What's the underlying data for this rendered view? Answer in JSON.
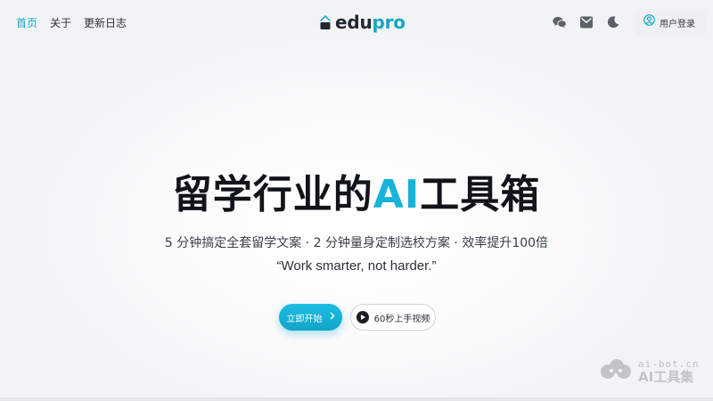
{
  "nav": {
    "items": [
      {
        "label": "首页",
        "active": true
      },
      {
        "label": "关于",
        "active": false
      },
      {
        "label": "更新日志",
        "active": false
      }
    ]
  },
  "brand": {
    "edu": "edu",
    "pro": "pro"
  },
  "header_tools": {
    "icons": [
      "wechat-icon",
      "mail-icon",
      "moon-icon"
    ],
    "login_label": "用户登录"
  },
  "hero": {
    "title_before": "留学行业的",
    "title_accent": "AI",
    "title_after": "工具箱",
    "subtitle": "5 分钟搞定全套留学文案 · 2 分钟量身定制选校方案 · 效率提升100倍",
    "quote": "“Work smarter, not harder.”"
  },
  "cta": {
    "primary_label": "立即开始",
    "secondary_label": "60秒上手视频"
  },
  "watermark": {
    "url": "ai-bot.cn",
    "name": "AI工具集"
  },
  "colors": {
    "accent": "#15a6c6",
    "title_accent": "#17b3d8"
  }
}
